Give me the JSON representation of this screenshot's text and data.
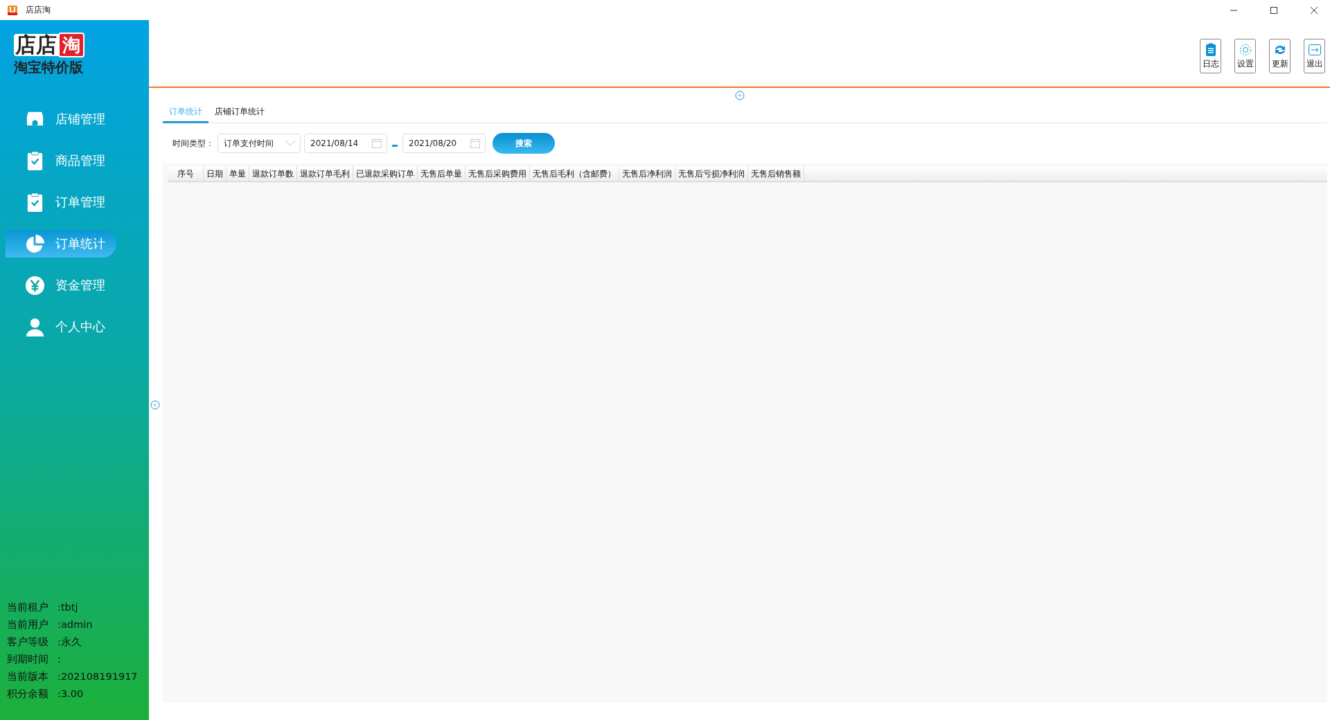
{
  "window": {
    "title": "店店淘"
  },
  "logo": {
    "name": "店店",
    "badge": "淘",
    "subtitle": "淘宝特价版"
  },
  "sidebar": {
    "items": [
      {
        "label": "店铺管理",
        "kind": "store",
        "selected": false
      },
      {
        "label": "商品管理",
        "kind": "clipboard",
        "selected": false
      },
      {
        "label": "订单管理",
        "kind": "clipboard",
        "selected": false
      },
      {
        "label": "订单统计",
        "kind": "pie",
        "selected": true
      },
      {
        "label": "资金管理",
        "kind": "yen",
        "selected": false
      },
      {
        "label": "个人中心",
        "kind": "user",
        "selected": false
      }
    ],
    "info": [
      {
        "label": "当前租户",
        "value": ":tbtj"
      },
      {
        "label": "当前用户",
        "value": ":admin"
      },
      {
        "label": "客户等级",
        "value": ":永久"
      },
      {
        "label": "到期时间",
        "value": ":"
      },
      {
        "label": "当前版本",
        "value": ":202108191917"
      },
      {
        "label": "积分余额",
        "value": ":3.00"
      }
    ]
  },
  "toolbar": [
    {
      "label": "日志",
      "kind": "log"
    },
    {
      "label": "设置",
      "kind": "settings"
    },
    {
      "label": "更新",
      "kind": "refresh"
    },
    {
      "label": "退出",
      "kind": "exit"
    }
  ],
  "tabs": [
    {
      "label": "订单统计",
      "selected": true
    },
    {
      "label": "店铺订单统计",
      "selected": false
    }
  ],
  "filter": {
    "label": "时间类型：",
    "time_type": "订单支付时间",
    "start_date": "2021/08/14",
    "end_date": "2021/08/20",
    "search_button": "搜索"
  },
  "table": {
    "columns": [
      "序号",
      "日期",
      "单量",
      "退款订单数",
      "退款订单毛利",
      "已退款采购订单",
      "无售后单量",
      "无售后采购费用",
      "无售后毛利（含邮费）",
      "无售后净利润",
      "无售后亏损净利润",
      "无售后销售额"
    ]
  }
}
